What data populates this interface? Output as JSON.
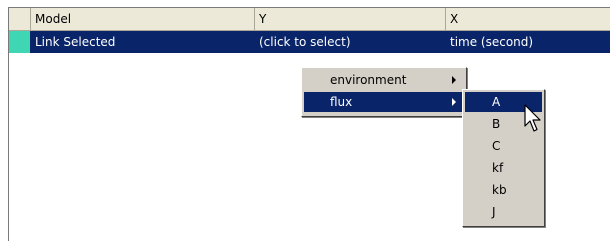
{
  "grid": {
    "columns": [
      "Model",
      "Y",
      "X"
    ],
    "rows": [
      {
        "model": "Link Selected",
        "y": "(click to select)",
        "x": "time (second)",
        "selected": true
      }
    ]
  },
  "context_menu": {
    "items": [
      {
        "label": "environment",
        "has_submenu": true
      },
      {
        "label": "flux",
        "has_submenu": true,
        "highlighted": true
      }
    ]
  },
  "submenu": {
    "items": [
      "A",
      "B",
      "C",
      "kf",
      "kb",
      "J"
    ],
    "highlighted": "A"
  },
  "colors": {
    "selection": "#0a246a",
    "row_indicator": "#3fd6b4",
    "menu_bg": "#d4d0c8",
    "header_bg": "#ece9d8"
  },
  "icons": {
    "cursor": "arrow-pointer-icon"
  }
}
